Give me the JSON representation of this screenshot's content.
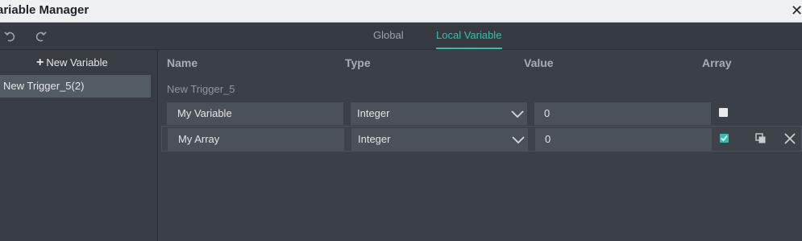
{
  "window": {
    "title": "ariable Manager",
    "close_icon": "close-icon"
  },
  "toolbar": {
    "undo_icon": "undo-icon",
    "redo_icon": "redo-icon",
    "tabs": [
      {
        "label": "Global"
      },
      {
        "label": "Local Variable",
        "active": true
      }
    ]
  },
  "sidebar": {
    "new_variable_label": "New Variable",
    "items": [
      {
        "label": "New Trigger_5(2)",
        "selected": true
      }
    ]
  },
  "table": {
    "headers": {
      "name": "Name",
      "type": "Type",
      "value": "Value",
      "array": "Array"
    },
    "group_label": "New Trigger_5",
    "rows": [
      {
        "name": "My Variable",
        "type": "Integer",
        "value": "0",
        "array": false
      },
      {
        "name": "My Array",
        "type": "Integer",
        "value": "0",
        "array": true
      }
    ]
  },
  "colors": {
    "accent": "#2fc2b0",
    "background": "#3a4046",
    "input": "#4a5158"
  }
}
